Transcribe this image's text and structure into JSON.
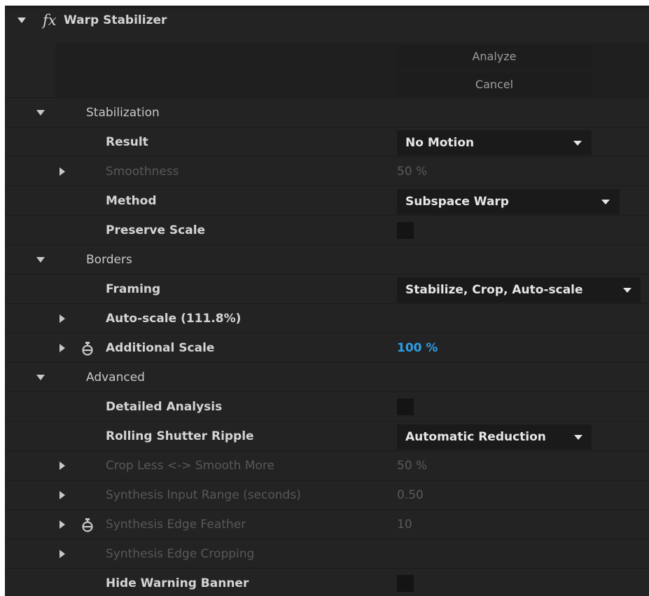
{
  "effect": {
    "fx_label": "fx",
    "title": "Warp Stabilizer"
  },
  "buttons": {
    "analyze": "Analyze",
    "cancel": "Cancel"
  },
  "stabilization": {
    "label": "Stabilization",
    "result": {
      "label": "Result",
      "value": "No Motion"
    },
    "smoothness": {
      "label": "Smoothness",
      "value": "50 %"
    },
    "method": {
      "label": "Method",
      "value": "Subspace Warp"
    },
    "preserve_scale": {
      "label": "Preserve Scale"
    }
  },
  "borders": {
    "label": "Borders",
    "framing": {
      "label": "Framing",
      "value": "Stabilize, Crop, Auto-scale"
    },
    "auto_scale": {
      "label": "Auto-scale (111.8%)"
    },
    "additional_scale": {
      "label": "Additional Scale",
      "value": "100 %"
    }
  },
  "advanced": {
    "label": "Advanced",
    "detailed_analysis": {
      "label": "Detailed Analysis"
    },
    "rolling_shutter": {
      "label": "Rolling Shutter Ripple",
      "value": "Automatic Reduction"
    },
    "crop_less": {
      "label": "Crop Less <-> Smooth More",
      "value": "50 %"
    },
    "synthesis_range": {
      "label": "Synthesis Input Range (seconds)",
      "value": "0.50"
    },
    "edge_feather": {
      "label": "Synthesis Edge Feather",
      "value": "10"
    },
    "edge_cropping": {
      "label": "Synthesis Edge Cropping"
    },
    "hide_warning": {
      "label": "Hide Warning Banner"
    }
  },
  "colors": {
    "panel_bg": "#232323",
    "link_blue": "#2f9ee6",
    "dim_text": "#585858"
  }
}
